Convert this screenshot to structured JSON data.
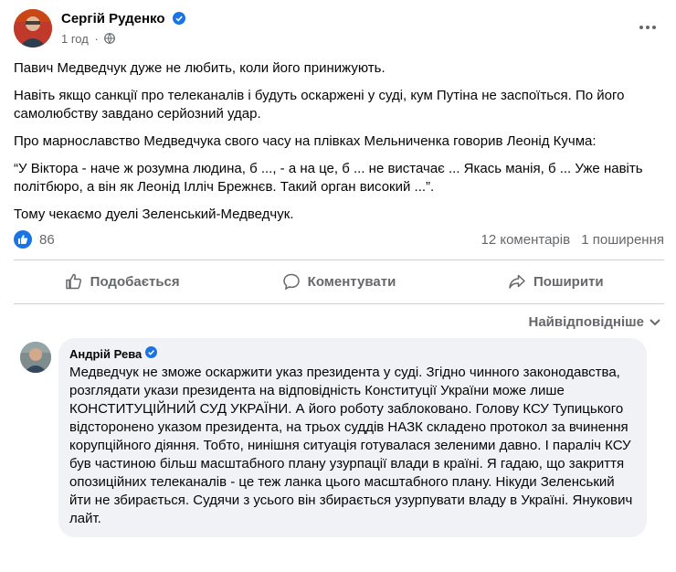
{
  "post": {
    "author": "Сергій Руденко",
    "time": "1 год",
    "separator": "·",
    "paragraphs": [
      "Павич Медведчук дуже не любить, коли його принижують.",
      "Навіть якщо санкції про телеканалів і будуть оскаржені у суді, кум Путіна не заспоїться. По його самолюбству завдано серйозний удар.",
      "Про марнославство Медведчука свого часу на плівках Мельниченка говорив Леонід Кучма:",
      "“У Віктора - наче ж розумна людина, б ..., - а на це, б ... не вистачає ... Якась манія, б ... Уже навіть політбюро, а він як Леонід Ілліч Брежнєв. Такий орган високий ...”.",
      "Тому чекаємо дуелі Зеленський-Медведчук."
    ]
  },
  "stats": {
    "likes": "86",
    "comments": "12 коментарів",
    "shares": "1 поширення"
  },
  "actions": {
    "like": "Подобається",
    "comment": "Коментувати",
    "share": "Поширити"
  },
  "sort": {
    "label": "Найвідповідніше"
  },
  "comment": {
    "author": "Андрій Рева",
    "text": "Медведчук не зможе оскаржити указ президента у суді. Згідно чинного законодавства, розглядати укази президента на відповідність Конституції України може лише КОНСТИТУЦІЙНИЙ СУД УКРАЇНИ. А його роботу заблоковано. Голову КСУ Тупицького відсторонено указом президента, на трьох суддів НАЗК складено протокол за вчинення корупційного діяння. Тобто, нинішня ситуація готувалася зеленими давно. І параліч КСУ був частиною більш масштабного плану узурпації влади в країні. Я гадаю, що закриття опозиційних телеканалів - це теж ланка цього масштабного плану. Нікуди Зеленський йти не збирається. Судячи з усього він збирається узурпувати владу в Україні. Янукович лайт."
  },
  "colors": {
    "accent": "#1b74e4",
    "secondary_text": "#65676b",
    "bubble": "#f0f2f5"
  }
}
